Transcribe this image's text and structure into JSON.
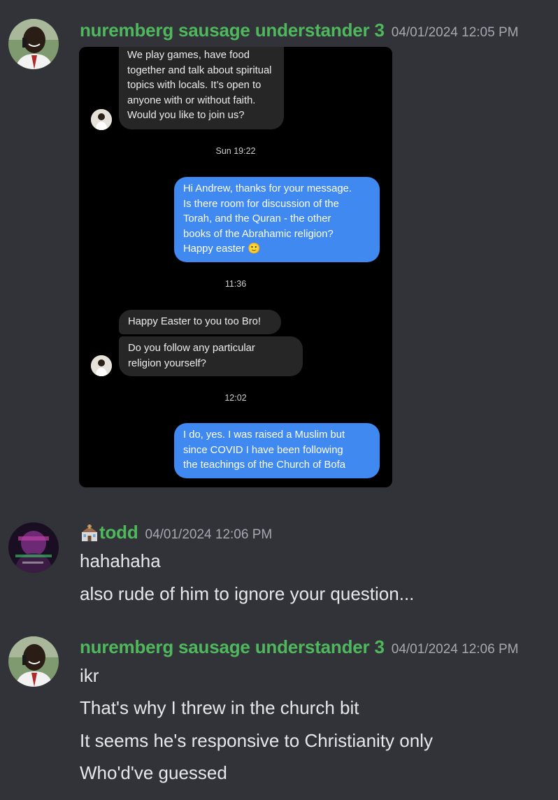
{
  "messages": [
    {
      "username": "nuremberg sausage understander 3",
      "timestamp": "04/01/2024 12:05 PM",
      "attachment": {
        "items": [
          {
            "kind": "incoming",
            "text_lines": [
              "We play games, have food",
              "together and talk about spiritual",
              "topics with locals. It’s open to",
              "anyone with or without faith.",
              "Would you like to join us?"
            ]
          },
          {
            "kind": "time",
            "text": "Sun 19:22"
          },
          {
            "kind": "outgoing",
            "text_lines": [
              "Hi Andrew, thanks for your message.",
              "Is there room for discussion of the",
              "Torah, and the Quran - the other",
              "books of the Abrahamic religion?",
              "Happy easter 🙂"
            ]
          },
          {
            "kind": "time",
            "text": "11:36"
          },
          {
            "kind": "incoming",
            "text_lines": [
              "Happy Easter to you too Bro!"
            ]
          },
          {
            "kind": "incoming",
            "text_lines": [
              "Do you follow any particular",
              "religion yourself?"
            ]
          },
          {
            "kind": "time",
            "text": "12:02"
          },
          {
            "kind": "outgoing",
            "text_lines": [
              "I do, yes. I was raised a Muslim but",
              "since COVID I have been following",
              "the teachings of the Church of Bofa"
            ]
          }
        ]
      }
    },
    {
      "username": "todd",
      "username_prefix_icon": "church-icon",
      "timestamp": "04/01/2024 12:06 PM",
      "lines": [
        "hahahaha",
        "also rude of him to ignore your question..."
      ]
    },
    {
      "username": "nuremberg sausage understander 3",
      "timestamp": "04/01/2024 12:06 PM",
      "lines": [
        "ikr",
        "That's why I threw in the church bit",
        "It seems he's responsive to Christianity only",
        "Who'd've guessed"
      ]
    }
  ],
  "colors": {
    "background": "#313338",
    "username": "#4fb85d",
    "timestamp": "#a5a8b0",
    "text": "#e6e7ea",
    "outgoing_bubble": "#3f89f0",
    "incoming_bubble": "#262626"
  }
}
